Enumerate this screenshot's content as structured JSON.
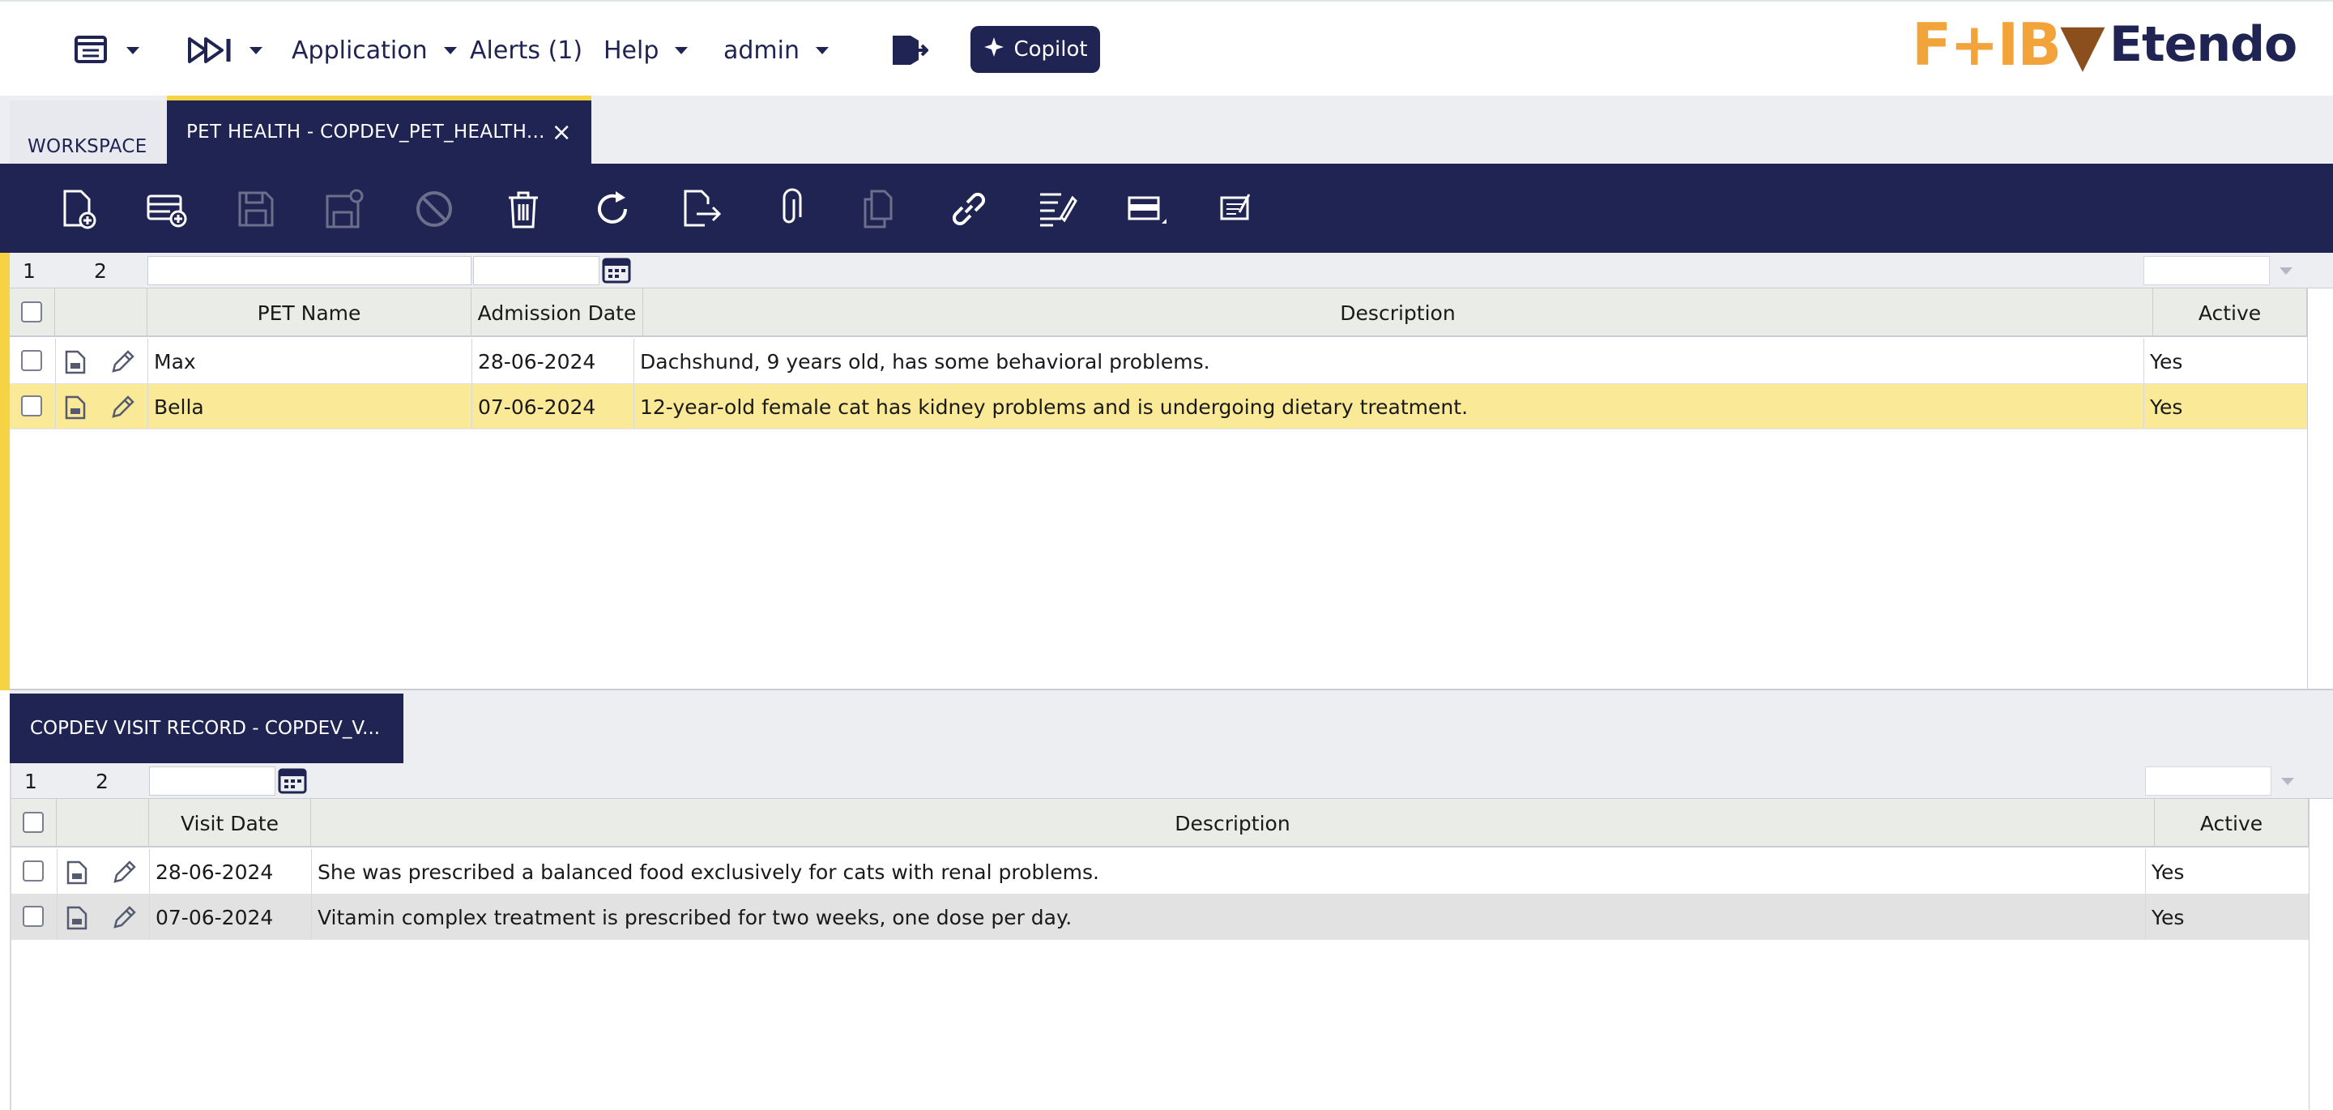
{
  "topnav": {
    "application_label": "Application",
    "alerts_label": "Alerts (1)",
    "help_label": "Help",
    "user_label": "admin",
    "copilot_label": "Copilot"
  },
  "brand": {
    "partner_logo_text": "F+IB",
    "etendo_logo_text": "Etendo"
  },
  "tabs": {
    "workspace_label": "WORKSPACE",
    "active_label": "PET HEALTH - COPDEV_PET_HEALTH...",
    "close_glyph": "×"
  },
  "toolbar": {
    "buttons": [
      "new-document",
      "new-row",
      "save",
      "save-and-close",
      "undo",
      "delete",
      "refresh",
      "export",
      "attach",
      "clone",
      "link",
      "audit-trail",
      "grid-form-toggle",
      "notes"
    ],
    "disabled": [
      "save",
      "save-and-close",
      "undo",
      "clone"
    ]
  },
  "parent_grid": {
    "page_first": "1",
    "page_second": "2",
    "columns": [
      "PET Name",
      "Admission Date",
      "Description",
      "Active"
    ],
    "rows": [
      {
        "name": "Max",
        "date": "28-06-2024",
        "description": "Dachshund, 9 years old, has some behavioral problems.",
        "active": "Yes"
      },
      {
        "name": "Bella",
        "date": "07-06-2024",
        "description": "12-year-old female cat has kidney problems and is undergoing dietary treatment.",
        "active": "Yes"
      }
    ],
    "selected_row_color": "#fae996"
  },
  "child_tab": {
    "label": "COPDEV VISIT RECORD - COPDEV_V..."
  },
  "child_grid": {
    "page_first": "1",
    "page_second": "2",
    "columns": [
      "Visit Date",
      "Description",
      "Active"
    ],
    "rows": [
      {
        "date": "28-06-2024",
        "description": "She was prescribed a balanced food exclusively for cats with renal problems.",
        "active": "Yes"
      },
      {
        "date": "07-06-2024",
        "description": "Vitamin complex treatment is prescribed for two weeks, one dose per day.",
        "active": "Yes"
      }
    ],
    "alt_row_color": "#e2e2e2"
  },
  "colors": {
    "navy": "#202452",
    "accent_yellow": "#f5d342",
    "brand_orange": "#f2a33a"
  }
}
